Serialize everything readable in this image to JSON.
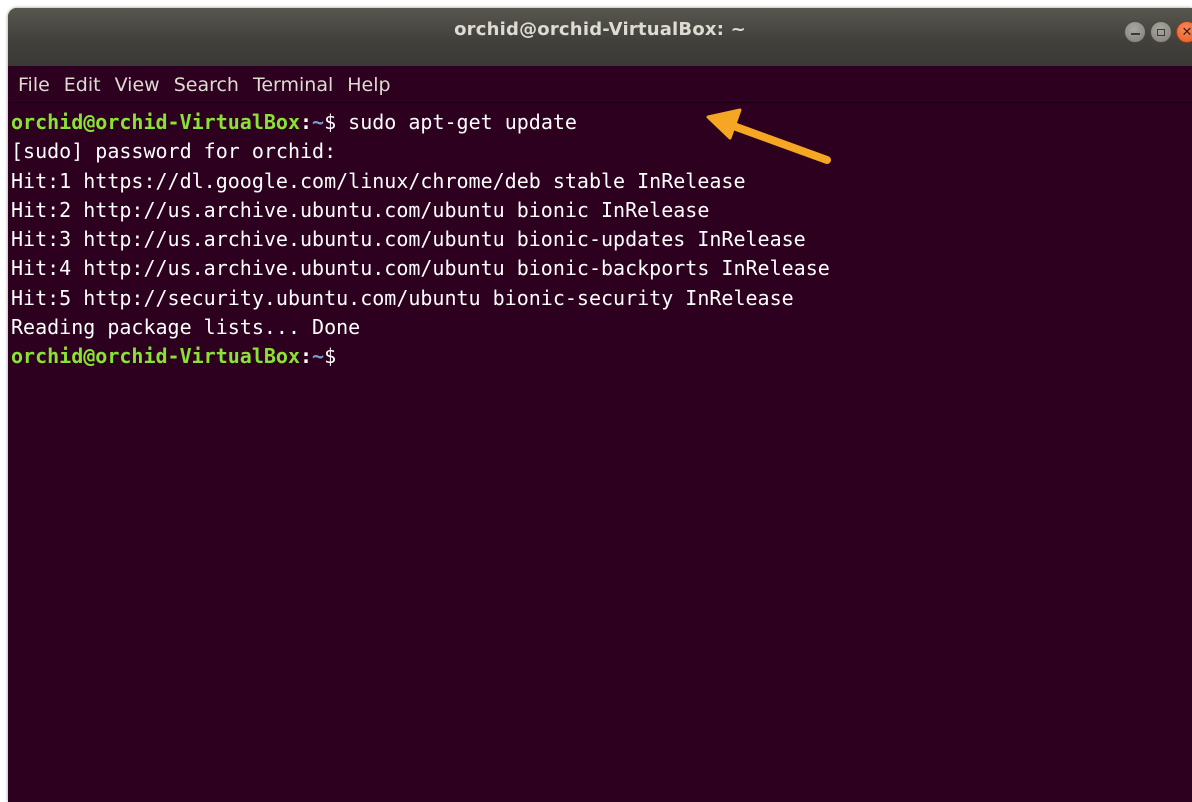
{
  "window": {
    "title": "orchid@orchid-VirtualBox: ~",
    "controls": {
      "minimize_icon": "minimize-icon",
      "maximize_icon": "maximize-icon",
      "close_icon": "close-icon"
    }
  },
  "menu": {
    "items": [
      {
        "label": "File"
      },
      {
        "label": "Edit"
      },
      {
        "label": "View"
      },
      {
        "label": "Search"
      },
      {
        "label": "Terminal"
      },
      {
        "label": "Help"
      }
    ]
  },
  "terminal": {
    "prompt_user": "orchid@orchid-VirtualBox",
    "prompt_sep": ":",
    "prompt_path": "~",
    "prompt_symbol": "$ ",
    "command": "sudo apt-get update",
    "output": [
      "[sudo] password for orchid:",
      "Hit:1 https://dl.google.com/linux/chrome/deb stable InRelease",
      "Hit:2 http://us.archive.ubuntu.com/ubuntu bionic InRelease",
      "Hit:3 http://us.archive.ubuntu.com/ubuntu bionic-updates InRelease",
      "Hit:4 http://us.archive.ubuntu.com/ubuntu bionic-backports InRelease",
      "Hit:5 http://security.ubuntu.com/ubuntu bionic-security InRelease",
      "Reading package lists... Done"
    ],
    "final_prompt_symbol": "$"
  },
  "colors": {
    "terminal_bg": "#2c001e",
    "prompt_user": "#8ae234",
    "prompt_path": "#729fcf",
    "text": "#ffffff",
    "arrow": "#f5a623",
    "close_button": "#e95420"
  },
  "annotation": {
    "icon": "arrow-icon"
  }
}
